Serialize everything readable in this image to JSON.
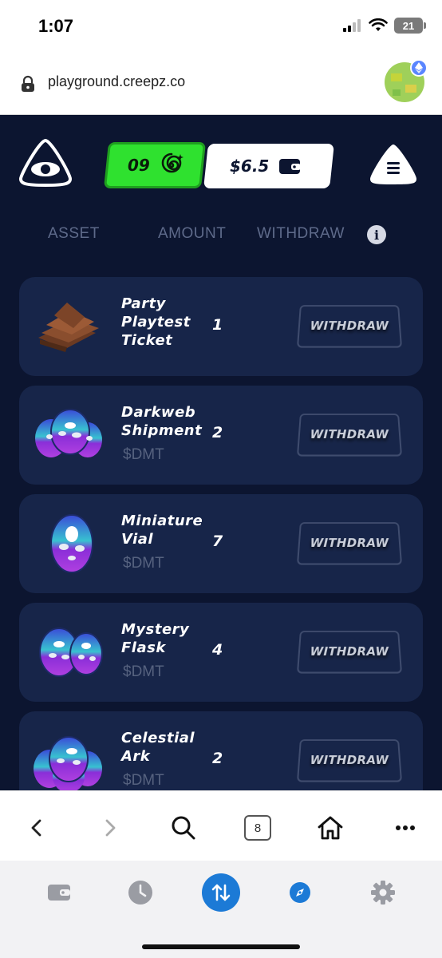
{
  "status_bar": {
    "time": "1:07",
    "battery": "21"
  },
  "browser": {
    "url": "playground.creepz.co"
  },
  "header": {
    "balance_count": "09",
    "balance_amount": "$6.5"
  },
  "columns": {
    "asset": "ASSET",
    "amount": "AMOUNT",
    "withdraw": "WITHDRAW",
    "info": "i"
  },
  "items": [
    {
      "name_lines": [
        "Party",
        "Playtest",
        "Ticket"
      ],
      "subtitle": "",
      "quantity": "1",
      "button": "WITHDRAW"
    },
    {
      "name_lines": [
        "Darkweb",
        "Shipment"
      ],
      "subtitle": "$DMT",
      "quantity": "2",
      "button": "WITHDRAW"
    },
    {
      "name_lines": [
        "Miniature",
        "Vial"
      ],
      "subtitle": "$DMT",
      "quantity": "7",
      "button": "WITHDRAW"
    },
    {
      "name_lines": [
        "Mystery",
        "Flask"
      ],
      "subtitle": "$DMT",
      "quantity": "4",
      "button": "WITHDRAW"
    },
    {
      "name_lines": [
        "Celestial",
        "Ark"
      ],
      "subtitle": "$DMT",
      "quantity": "2",
      "button": "WITHDRAW"
    }
  ],
  "toolbar": {
    "tabs_count": "8"
  },
  "colors": {
    "app_bg": "#0c1530",
    "card_bg": "#172549",
    "green": "#2fe12f",
    "active_blue": "#1c7ad6"
  }
}
